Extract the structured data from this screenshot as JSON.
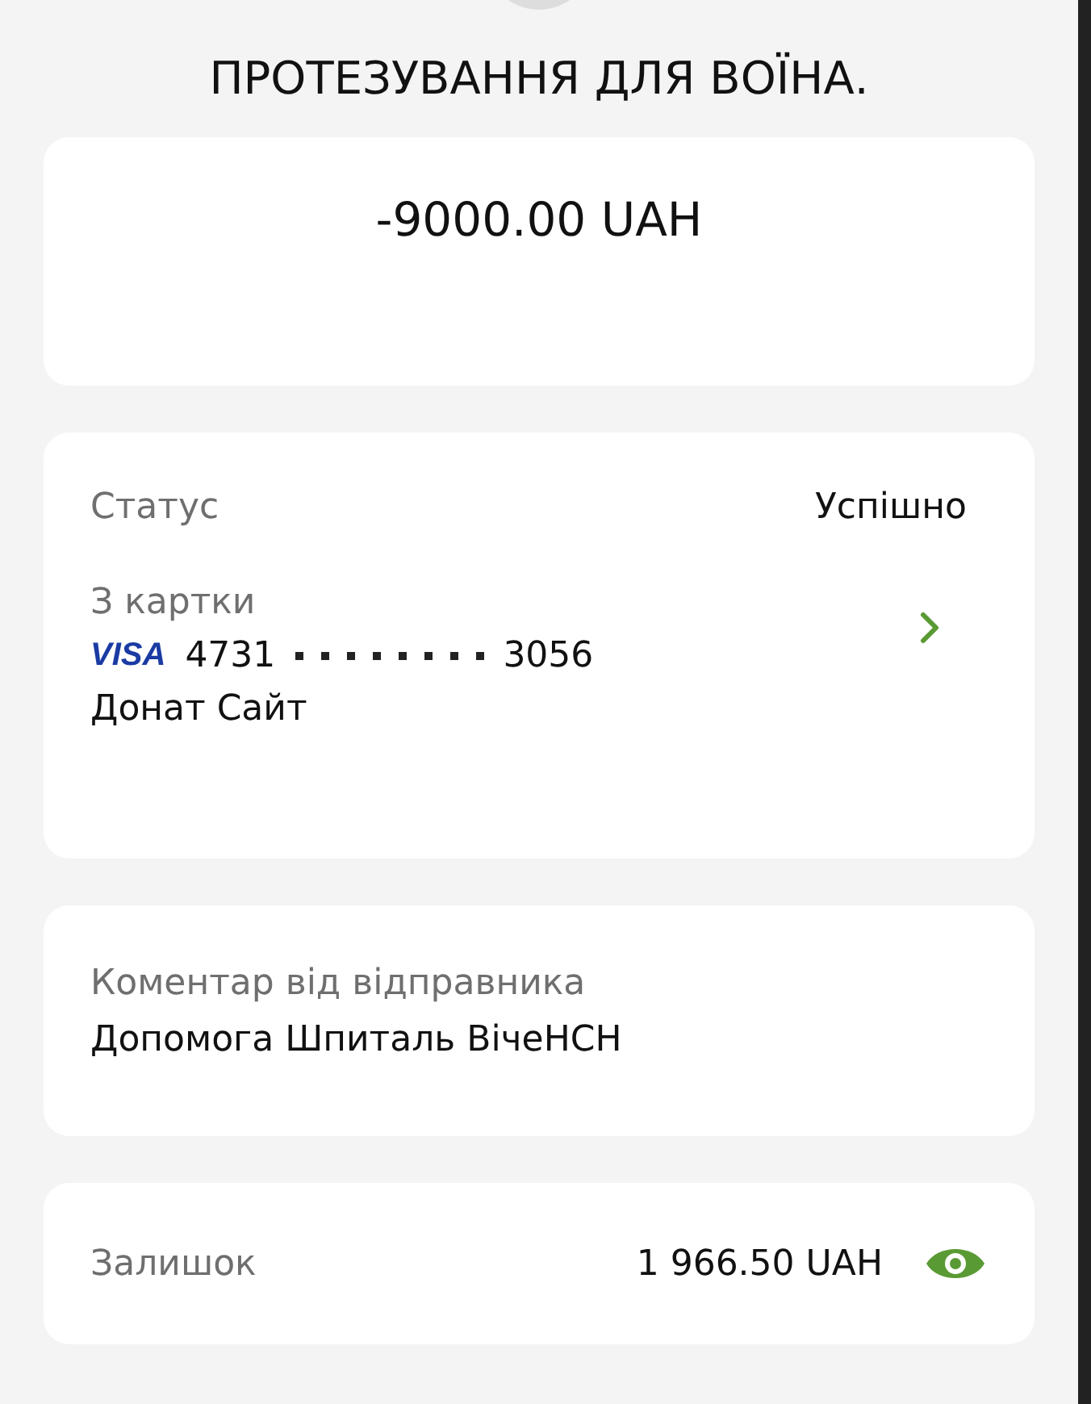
{
  "title": "ПРОТЕЗУВАННЯ ДЛЯ ВОЇНА.",
  "amount": "-9000.00 UAH",
  "status": {
    "label": "Статус",
    "value": "Успішно"
  },
  "card": {
    "label": "З картки",
    "brand": "VISA",
    "first": "4731",
    "last": "3056",
    "name": "Донат Сайт"
  },
  "comment": {
    "label": "Коментар від відправника",
    "value": "Допомога Шпиталь ВічеНСН"
  },
  "balance": {
    "label": "Залишок",
    "value": "1 966.50 UAH"
  }
}
